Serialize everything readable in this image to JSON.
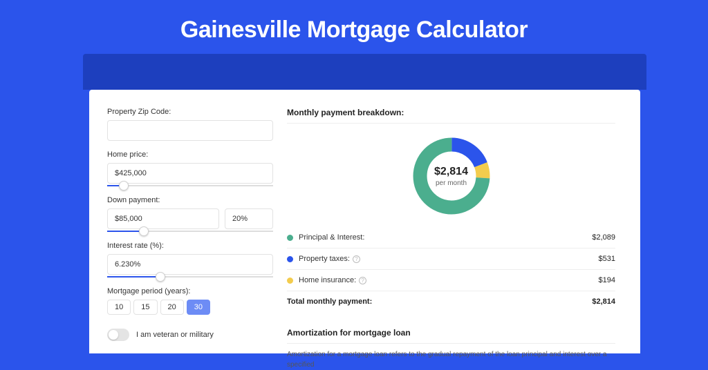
{
  "title": "Gainesville Mortgage Calculator",
  "form": {
    "zip_label": "Property Zip Code:",
    "zip_value": "",
    "home_price_label": "Home price:",
    "home_price_value": "$425,000",
    "home_price_slider_pct": 10,
    "down_payment_label": "Down payment:",
    "down_payment_value": "$85,000",
    "down_payment_pct": "20%",
    "down_payment_slider_pct": 22,
    "interest_label": "Interest rate (%):",
    "interest_value": "6.230%",
    "interest_slider_pct": 32,
    "period_label": "Mortgage period (years):",
    "period_options": [
      "10",
      "15",
      "20",
      "30"
    ],
    "period_selected": "30",
    "veteran_label": "I am veteran or military"
  },
  "breakdown": {
    "title": "Monthly payment breakdown:",
    "center_amount": "$2,814",
    "center_sub": "per month",
    "items": [
      {
        "label": "Principal & Interest:",
        "value": "$2,089",
        "color": "#4bae8e",
        "help": false,
        "pct": 74
      },
      {
        "label": "Property taxes:",
        "value": "$531",
        "color": "#2b54eb",
        "help": true,
        "pct": 19
      },
      {
        "label": "Home insurance:",
        "value": "$194",
        "color": "#f3cc4d",
        "help": true,
        "pct": 7
      }
    ],
    "total_label": "Total monthly payment:",
    "total_value": "$2,814"
  },
  "amort": {
    "title": "Amortization for mortgage loan",
    "body": "Amortization for a mortgage loan refers to the gradual repayment of the loan principal and interest over a specified"
  },
  "chart_data": {
    "type": "pie",
    "title": "Monthly payment breakdown",
    "series": [
      {
        "name": "Principal & Interest",
        "value": 2089,
        "color": "#4bae8e"
      },
      {
        "name": "Property taxes",
        "value": 531,
        "color": "#2b54eb"
      },
      {
        "name": "Home insurance",
        "value": 194,
        "color": "#f3cc4d"
      }
    ],
    "total": 2814,
    "unit": "USD per month"
  }
}
